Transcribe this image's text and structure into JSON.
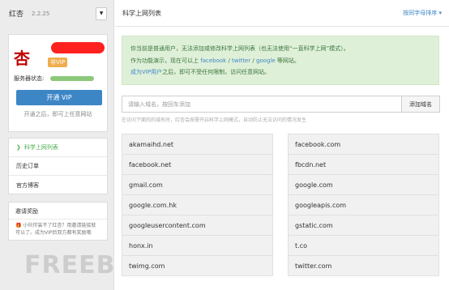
{
  "app": {
    "name": "红杏",
    "version": "2.2.25",
    "dropdown_icon": "caret-down-icon"
  },
  "user": {
    "avatar_char": "杏",
    "vip_badge": "非VIP",
    "status_label": "服务器状态:",
    "status_color": "#8cc97a"
  },
  "vip": {
    "button_label": "开通 VIP",
    "tip": "开通之后，即可上任意网站"
  },
  "nav": {
    "items": [
      {
        "label": "科学上网列表",
        "active": true
      },
      {
        "label": "历史订单",
        "active": false
      },
      {
        "label": "官方博客",
        "active": false
      }
    ]
  },
  "invite": {
    "title": "邀请奖励",
    "text": "小伙伴装不了红杏？用邀请链接就可以了。成为VIP后双方都有奖励哦"
  },
  "watermark": "FREEBUF",
  "main": {
    "title": "科学上网列表",
    "sort_link": "按同字母排序 ▾",
    "alert": {
      "line1": "你当前是普通用户，无法添加或修改科学上网列表（也无法使用“一直科学上网”模式）。",
      "line2_pre": "作为功能演示，现在可以上 ",
      "line2_link1": "facebook",
      "line2_sep1": " / ",
      "line2_link2": "twitter",
      "line2_sep2": " / ",
      "line2_link3": "google",
      "line2_post": " 等网站。",
      "line3_link": "成为VIP用户",
      "line3_post": "之后，即可不受任何限制，访问任意网站。"
    },
    "search": {
      "placeholder": "请输入域名，按回车添加",
      "add_label": "添加域名"
    },
    "hint": "在访问下面的的域名时，红杏会按需开启科学上网模式，自动防止无法访问的情况发生",
    "domains_left": [
      "akamaihd.net",
      "facebook.net",
      "gmail.com",
      "google.com.hk",
      "googleusercontent.com",
      "honx.in",
      "twimg.com"
    ],
    "domains_right": [
      "facebook.com",
      "fbcdn.net",
      "google.com",
      "googleapis.com",
      "gstatic.com",
      "t.co",
      "twitter.com"
    ]
  }
}
